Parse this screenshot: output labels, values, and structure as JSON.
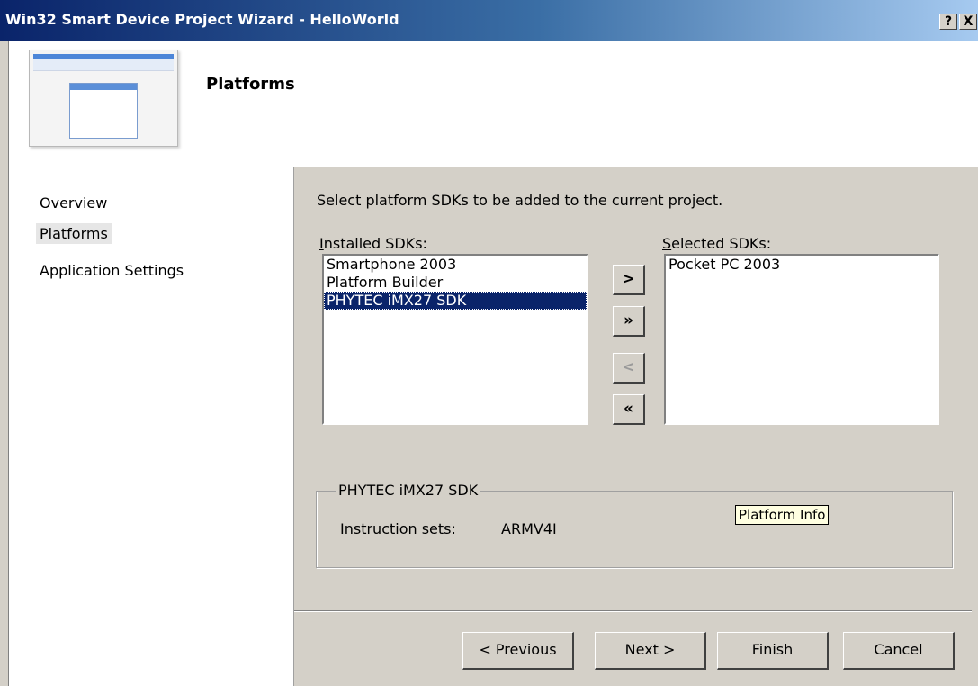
{
  "window": {
    "title": "Win32 Smart Device Project Wizard - HelloWorld",
    "help_label": "?",
    "close_label": "X"
  },
  "header": {
    "title": "Platforms"
  },
  "nav": {
    "items": [
      {
        "label": "Overview"
      },
      {
        "label": "Platforms",
        "active": true
      },
      {
        "label": "Application Settings"
      }
    ]
  },
  "main": {
    "intro": "Select platform SDKs to be added to the current project.",
    "installed_label": "Installed SDKs:",
    "selected_label": "Selected SDKs:",
    "installed_sdks": [
      "Smartphone 2003",
      "Platform Builder",
      "PHYTEC iMX27 SDK"
    ],
    "installed_selected_index": 2,
    "selected_sdks": [
      "Pocket PC 2003"
    ],
    "move_buttons": {
      "add": ">",
      "add_all": "»",
      "remove": "<",
      "remove_all": "«"
    },
    "info": {
      "title": "PHYTEC iMX27 SDK",
      "instruction_sets_label": "Instruction sets:",
      "instruction_sets_value": "ARMV4I",
      "tooltip": "Platform Info"
    }
  },
  "buttons": {
    "previous": "< Previous",
    "next": "Next >",
    "finish": "Finish",
    "cancel": "Cancel"
  },
  "colors": {
    "selection": "#0a246a",
    "titlebar_start": "#0a246a",
    "titlebar_end": "#a6caf0",
    "dialog_bg": "#d4d0c8",
    "tooltip_bg": "#ffffe1"
  }
}
